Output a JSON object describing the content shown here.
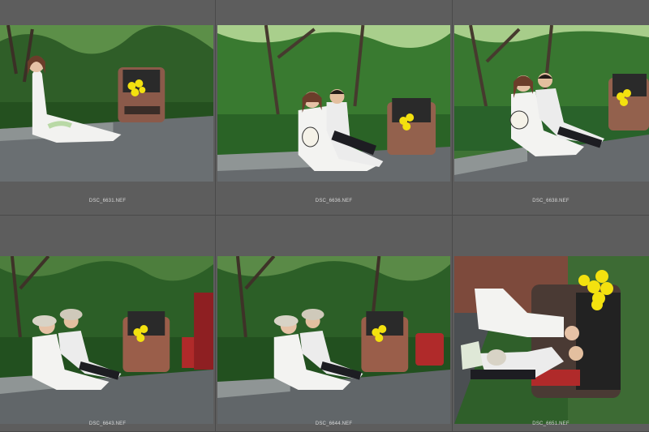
{
  "grid": {
    "thumbnails": [
      {
        "filename": "DSC_6631.NEF",
        "scene": "bride-alone"
      },
      {
        "filename": "DSC_6636.NEF",
        "scene": "couple-sitting"
      },
      {
        "filename": "DSC_6638.NEF",
        "scene": "couple-sitting"
      },
      {
        "filename": "DSC_6643.NEF",
        "scene": "couple-hats"
      },
      {
        "filename": "DSC_6644.NEF",
        "scene": "couple-hats"
      },
      {
        "filename": "DSC_6651.NEF",
        "scene": "couple-rotated"
      }
    ]
  },
  "colors": {
    "background": "#5c5c5c",
    "foliage": "#2f6a2a",
    "road": "#5e6468",
    "balloon": "#f3e10f"
  }
}
